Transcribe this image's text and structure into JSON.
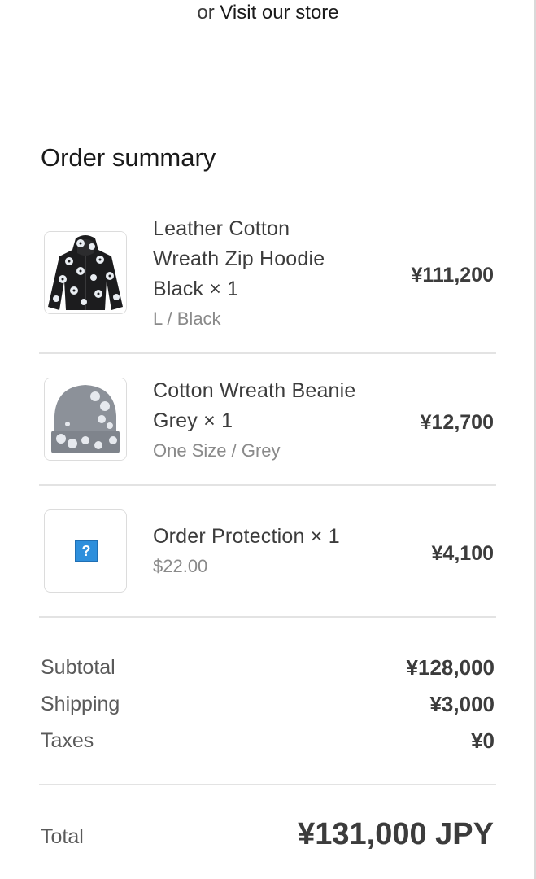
{
  "header": {
    "visit_prefix": "or",
    "visit_link": "Visit our store"
  },
  "summary": {
    "title": "Order summary"
  },
  "items": [
    {
      "name_lines": [
        "Leather Cotton",
        "Wreath Zip Hoodie",
        "Black × 1"
      ],
      "variant": "L / Black",
      "price": "¥111,200",
      "icon": "hoodie-image"
    },
    {
      "name_lines": [
        "Cotton Wreath Beanie",
        "Grey × 1"
      ],
      "variant": "One Size / Grey",
      "price": "¥12,700",
      "icon": "beanie-image"
    },
    {
      "name_lines": [
        "Order Protection × 1"
      ],
      "variant": "$22.00",
      "price": "¥4,100",
      "icon": "question-icon",
      "icon_glyph": "?"
    }
  ],
  "costs": {
    "subtotal_label": "Subtotal",
    "subtotal_value": "¥128,000",
    "shipping_label": "Shipping",
    "shipping_value": "¥3,000",
    "taxes_label": "Taxes",
    "taxes_value": "¥0"
  },
  "total": {
    "label": "Total",
    "value": "¥131,000 JPY"
  },
  "colors": {
    "text": "#3c3c3c",
    "muted": "#8a8a8a",
    "divider": "#e3e3e3",
    "accent_icon": "#2e8fdc"
  }
}
